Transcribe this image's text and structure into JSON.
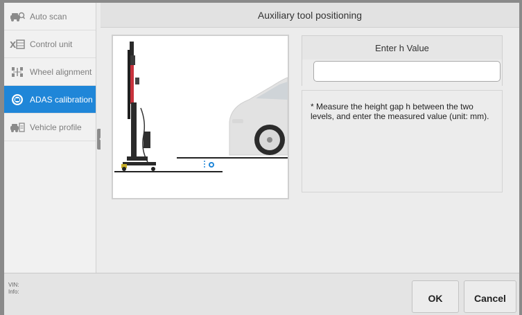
{
  "sidebar": {
    "items": [
      {
        "label": "Auto scan",
        "icon": "car-search-icon",
        "active": false
      },
      {
        "label": "Control unit",
        "icon": "control-unit-icon",
        "active": false
      },
      {
        "label": "Wheel alignment",
        "icon": "wheel-alignment-icon",
        "active": false
      },
      {
        "label": "ADAS calibration",
        "icon": "adas-icon",
        "active": true
      },
      {
        "label": "Vehicle profile",
        "icon": "vehicle-profile-icon",
        "active": false
      }
    ]
  },
  "main": {
    "title": "Auxiliary tool positioning",
    "h_panel": {
      "header": "Enter h Value",
      "input_value": ""
    },
    "note": "* Measure the height gap h between the two levels, and enter the measured value (unit: mm)."
  },
  "footer": {
    "vin_label": "VIN:",
    "info_label": "Info:",
    "ok_label": "OK",
    "cancel_label": "Cancel"
  },
  "colors": {
    "accent": "#1f86d8",
    "pole_red": "#c8323c"
  }
}
